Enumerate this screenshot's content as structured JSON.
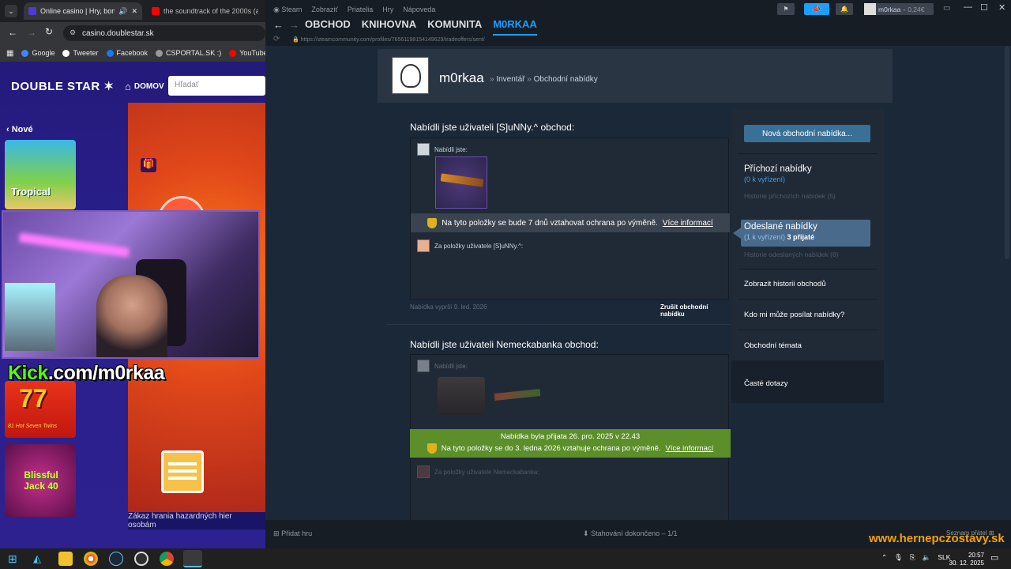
{
  "chrome": {
    "tabs": [
      {
        "title": "Online casino | Hry, bonusy"
      },
      {
        "title": "the soundtrack of the 2000s (a"
      }
    ],
    "url": "casino.doublestar.sk",
    "bookmarks": [
      "Google",
      "Tweeter",
      "Facebook",
      "CSPORTAL.SK :)",
      "YouTube"
    ]
  },
  "casino": {
    "logo": "DOUBLE STAR",
    "home": "DOMOV",
    "search_placeholder": "Hľadať",
    "new_label": "Nové",
    "games": [
      "Tropical",
      "81 Hot Seven Twins",
      "Blissful Jack 40"
    ],
    "gambling_notice": "Zákaz hrania hazardných hier osobám"
  },
  "stream": {
    "kick_prefix": "Kick",
    "kick_rest": ".com/m0rkaa",
    "watermark": "www.hernepczostavy.sk"
  },
  "steam": {
    "titlebar": {
      "brand": "Steam",
      "menus": [
        "Zobraziť",
        "Priatelia",
        "Hry",
        "Nápoveda"
      ],
      "user": "m0rkaa",
      "balance": "0,24€"
    },
    "nav": [
      "OBCHOD",
      "KNIHOVNA",
      "KOMUNITA",
      "M0RKAA"
    ],
    "url": "https://steamcommunity.com/profiles/76561198154149629/tradeoffers/sent/",
    "profile_name": "m0rkaa",
    "breadcrumb": {
      "inventory": "Inventář",
      "offers": "Obchodní nabídky"
    },
    "offers": [
      {
        "title": "Nabídli jste uživateli [S]uNNy.^ obchod:",
        "you_offered": "Nabídli jste:",
        "protection": "Na tyto položky se bude 7 dnů vztahovat ochrana po výměně.",
        "more_info": "Více informací",
        "for_items": "Za položky uživatele [S]uNNy.^:",
        "expires": "Nabídka vyprší 9. led. 2026",
        "cancel": "Zrušit obchodní nabídku"
      },
      {
        "title": "Nabídli jste uživateli Nemeckabanka obchod:",
        "you_offered": "Nabídli jste:",
        "accepted": "Nabídka byla přijata 26. pro. 2025 v 22.43",
        "protection": "Na tyto položky se do 3. ledna 2026 vztahuje ochrana po výměně.",
        "more_info": "Více informací",
        "for_items": "Za položky uživatele Nemeckabanka:"
      }
    ],
    "sidebar": {
      "new_offer": "Nová obchodní nabídka...",
      "incoming": "Příchozí nabídky",
      "incoming_pending": "(0 k vyřízení)",
      "incoming_history": "Historie příchozích nabídek (5)",
      "sent": "Odeslané nabídky",
      "sent_pending": "(1 k vyřízení)",
      "sent_accepted": "3 přijaté",
      "sent_history": "Historie odeslaných nabídek (6)",
      "trade_history": "Zobrazit historii obchodů",
      "who_can": "Kdo mi může posílat nabídky?",
      "topics": "Obchodní témata",
      "faq": "Časté dotazy"
    },
    "bottom": {
      "add_game": "Přidat hru",
      "downloads": "Stahování dokončeno – 1/1",
      "friends": "Seznam přátel"
    }
  },
  "taskbar": {
    "lang": "SLK",
    "time": "20:57",
    "date": "30. 12. 2025"
  }
}
